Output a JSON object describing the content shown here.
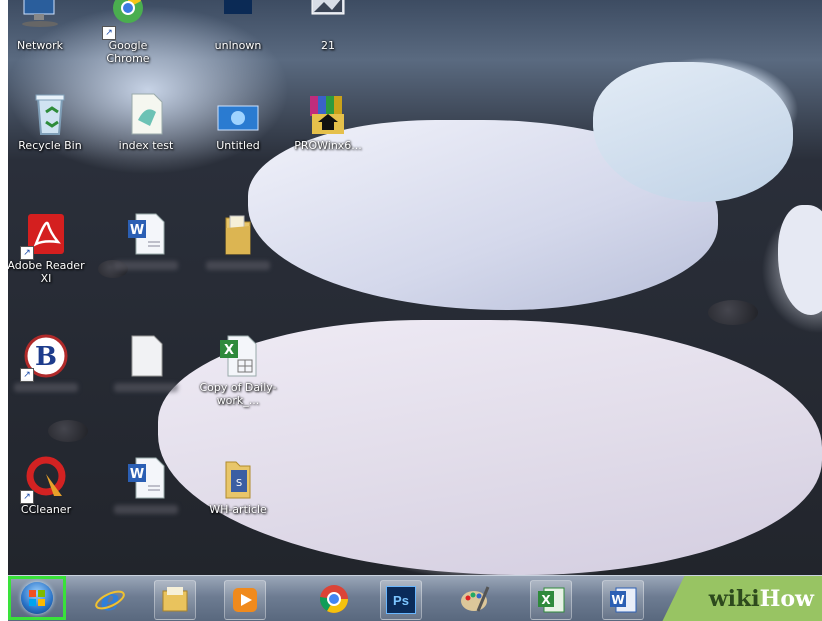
{
  "desktop": {
    "icons": [
      {
        "label": "Network",
        "icon": "network-icon"
      },
      {
        "label": "Google Chrome",
        "icon": "chrome-icon"
      },
      {
        "label": "unlnown",
        "icon": "photoshop-file-icon"
      },
      {
        "label": "21",
        "icon": "image-file-icon"
      },
      {
        "label": "Recycle Bin",
        "icon": "recycle-bin-icon"
      },
      {
        "label": "index test",
        "icon": "text-file-icon"
      },
      {
        "label": "Untitled",
        "icon": "image-file-icon"
      },
      {
        "label": "PROWinx6...",
        "icon": "winrar-icon"
      },
      {
        "label": "Adobe Reader XI",
        "icon": "adobe-reader-icon"
      },
      {
        "label": "",
        "icon": "word-document-icon"
      },
      {
        "label": "",
        "icon": "folder-icon"
      },
      {
        "label": "",
        "icon": "app-b-icon"
      },
      {
        "label": "",
        "icon": "blank-document-icon"
      },
      {
        "label": "Copy of Daily-work_...",
        "icon": "excel-document-icon"
      },
      {
        "label": "CCleaner",
        "icon": "ccleaner-icon"
      },
      {
        "label": "",
        "icon": "word-document-icon"
      },
      {
        "label": "WH-article",
        "icon": "folder-icon"
      }
    ]
  },
  "taskbar": {
    "start_icon": "windows-logo-icon",
    "items": [
      {
        "icon": "internet-explorer-icon"
      },
      {
        "icon": "file-explorer-icon"
      },
      {
        "icon": "media-player-icon"
      },
      {
        "icon": "chrome-icon"
      },
      {
        "icon": "photoshop-icon",
        "text": "Ps"
      },
      {
        "icon": "paint-icon"
      },
      {
        "icon": "excel-icon"
      },
      {
        "icon": "word-icon"
      }
    ],
    "watermark": {
      "part1": "wiki",
      "part2": "How"
    }
  },
  "colors": {
    "highlight": "#39e23a",
    "watermark_bg": "#98c463"
  }
}
